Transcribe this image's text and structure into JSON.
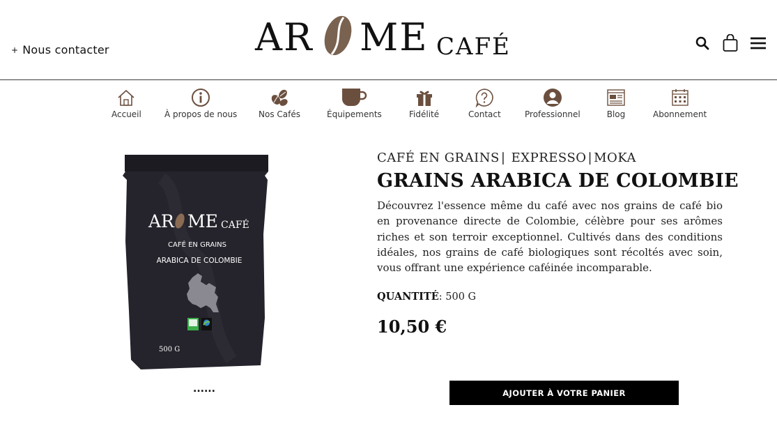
{
  "header": {
    "contact_plus": "+",
    "contact_label": "Nous contacter",
    "logo": {
      "part1": "AR",
      "part2": "ME",
      "part3": "CAFÉ",
      "bean_color": "#7a6250"
    },
    "icons": [
      "search-icon",
      "cart-icon",
      "menu-icon"
    ]
  },
  "nav": {
    "items": [
      {
        "label": "Accueil",
        "icon": "home-icon"
      },
      {
        "label": "À propos de nous",
        "icon": "info-icon"
      },
      {
        "label": "Nos Cafés",
        "icon": "coffee-beans-icon"
      },
      {
        "label": "Équipements",
        "icon": "coffee-cup-icon"
      },
      {
        "label": "Fidélité",
        "icon": "gift-icon"
      },
      {
        "label": "Contact",
        "icon": "question-icon"
      },
      {
        "label": "Professionnel",
        "icon": "user-icon"
      },
      {
        "label": "Blog",
        "icon": "blog-icon"
      },
      {
        "label": "Abonnement",
        "icon": "calendar-icon"
      }
    ],
    "icon_color": "#6b4f3e"
  },
  "product": {
    "categories": [
      "CAFÉ EN GRAINS",
      "EXPRESSO",
      "MOKA"
    ],
    "title": "GRAINS ARABICA DE COLOMBIE",
    "description": "Découvrez l'essence même du café avec nos grains de café bio en provenance directe de Colombie, célèbre pour ses arômes riches et son terroir exceptionnel. Cultivés dans des conditions idéales, nos grains de café biologiques sont récoltés avec soin, vous offrant une expérience caféinée incomparable.",
    "quantity_label": "QUANTITÉ",
    "quantity_value": ": 500 G",
    "price": "10,50 €",
    "add_to_cart": "AJOUTER À VOTRE PANIER",
    "gallery_dots": "......",
    "package": {
      "logo_part1": "AR",
      "logo_part2": "ME",
      "logo_part3": "CAFÉ",
      "line1": "CAFÉ EN GRAINS",
      "line2": "ARABICA DE COLOMBIE",
      "weight": "500 G",
      "bag_color": "#25232b",
      "map_color": "#8a8890"
    }
  }
}
